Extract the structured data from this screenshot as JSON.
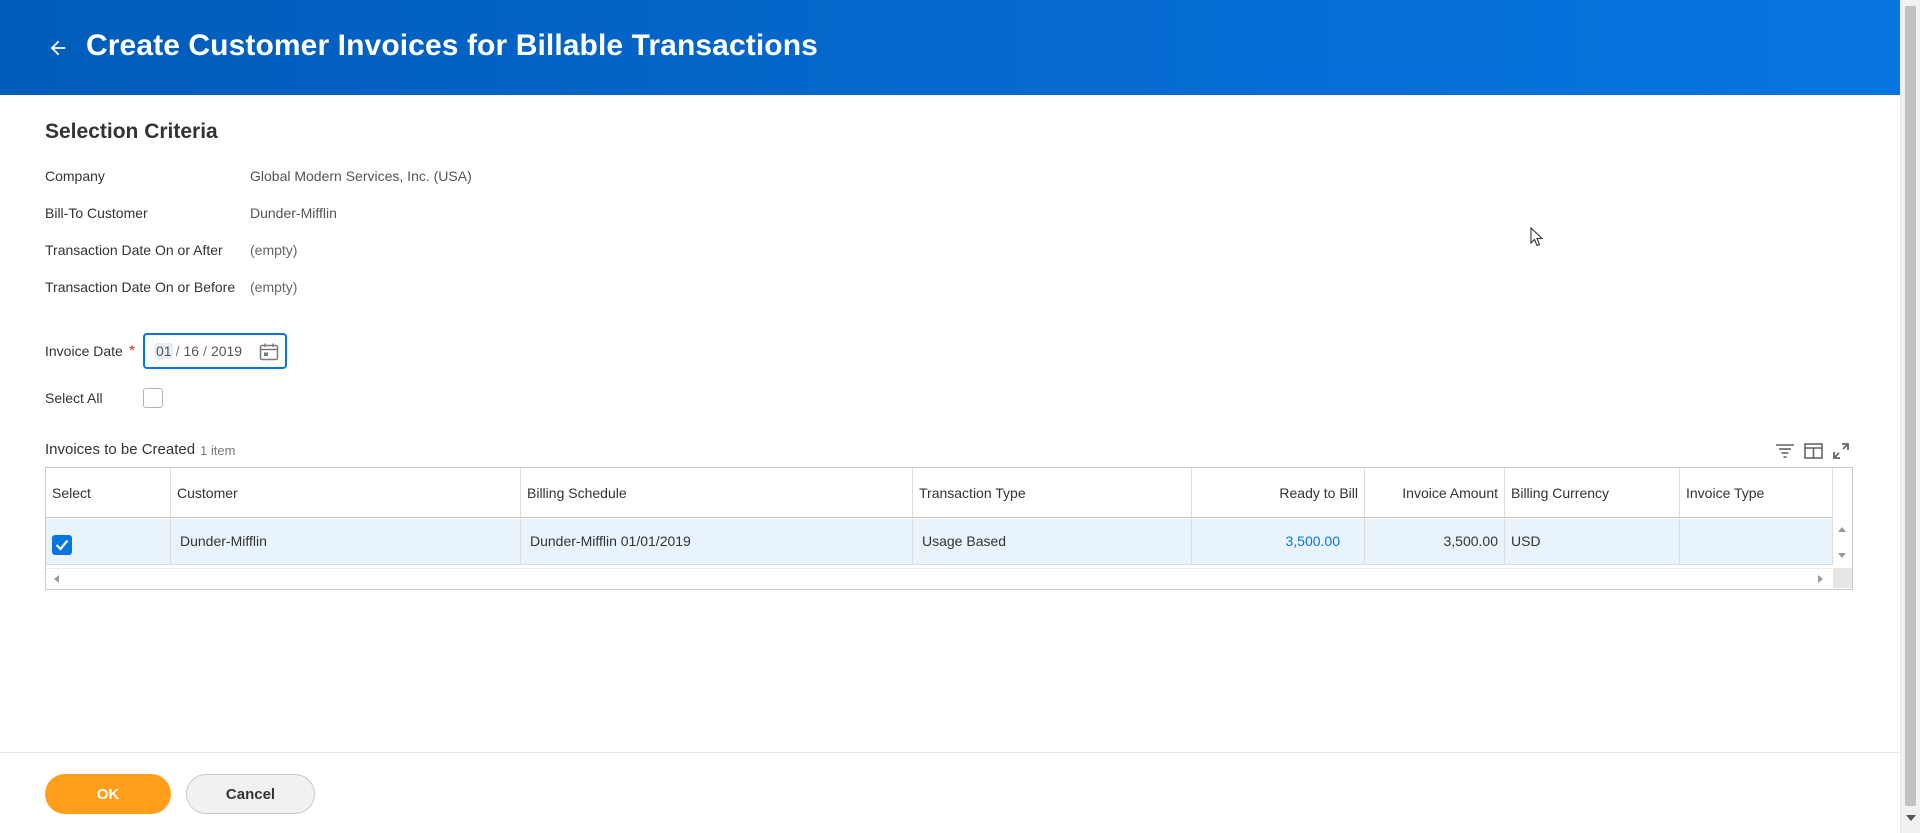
{
  "header": {
    "title": "Create Customer Invoices for Billable Transactions",
    "back_icon": "arrow-left-icon",
    "colors": {
      "brand_blue": "#0875e1",
      "brand_blue_dark": "#005cb9"
    }
  },
  "selection_criteria": {
    "title": "Selection Criteria",
    "fields": [
      {
        "label": "Company",
        "value": "Global Modern Services, Inc. (USA)"
      },
      {
        "label": "Bill-To Customer",
        "value": "Dunder-Mifflin"
      },
      {
        "label": "Transaction Date On or After",
        "value": "(empty)"
      },
      {
        "label": "Transaction Date On or Before",
        "value": "(empty)"
      }
    ],
    "invoice_date": {
      "label": "Invoice Date",
      "required": "*",
      "month": "01",
      "day": "16",
      "year": "2019",
      "sep": "/"
    },
    "select_all": {
      "label": "Select All",
      "checked": false
    }
  },
  "grid": {
    "title": "Invoices to be Created",
    "count": "1 item",
    "columns": [
      "Select",
      "Customer",
      "Billing Schedule",
      "Transaction Type",
      "Ready to Bill",
      "Invoice Amount",
      "Billing Currency",
      "Invoice Type"
    ],
    "rows": [
      {
        "selected": true,
        "customer": "Dunder-Mifflin",
        "billing_schedule": "Dunder-Mifflin 01/01/2019",
        "transaction_type": "Usage Based",
        "ready_to_bill": "3,500.00",
        "invoice_amount": "3,500.00",
        "billing_currency": "USD",
        "invoice_type": ""
      }
    ],
    "tools": [
      "filter-icon",
      "column-layout-icon",
      "expand-icon"
    ]
  },
  "footer": {
    "ok_label": "OK",
    "cancel_label": "Cancel",
    "colors": {
      "ok": "#ff9e1b"
    }
  }
}
